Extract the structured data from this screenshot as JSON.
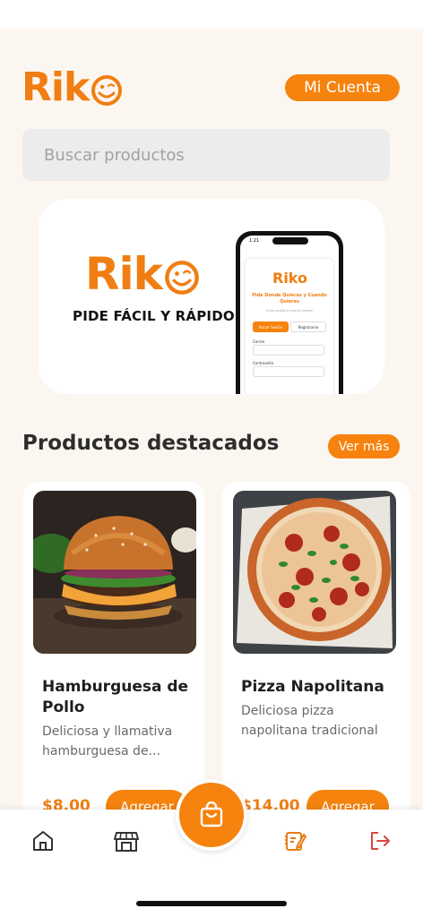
{
  "header": {
    "logo_text": "Rik",
    "account_label": "Mi Cuenta"
  },
  "search": {
    "placeholder": "Buscar productos"
  },
  "banner": {
    "logo_text": "Rik",
    "tagline": "PIDE FÁCIL Y RÁPIDO",
    "phone": {
      "time": "1:21",
      "logo_text": "Riko",
      "title": "Pide Donde Quieras y Cuando Quieras",
      "subtitle": "Inicia sesión o crea tu cuenta",
      "tab_login": "Iniciar Sesión",
      "tab_register": "Registrarse",
      "field1_label": "Correo",
      "field2_label": "Contraseña"
    }
  },
  "featured": {
    "title": "Productos destacados",
    "see_more": "Ver más",
    "products": [
      {
        "name": "Hamburguesa de Pollo",
        "description": "Deliciosa y llamativa hamburguesa de...",
        "price": "$8.00",
        "add_label": "Agregar"
      },
      {
        "name": "Pizza Napolitana",
        "description": "Deliciosa pizza napolitana tradicional",
        "price": "$14.00",
        "add_label": "Agregar"
      }
    ]
  },
  "nav": {
    "items": [
      "home-icon",
      "store-icon",
      "cart-icon",
      "orders-icon",
      "logout-icon"
    ]
  },
  "colors": {
    "accent": "#f5830e",
    "background": "#fcf6f1",
    "logout": "#d9453d"
  }
}
